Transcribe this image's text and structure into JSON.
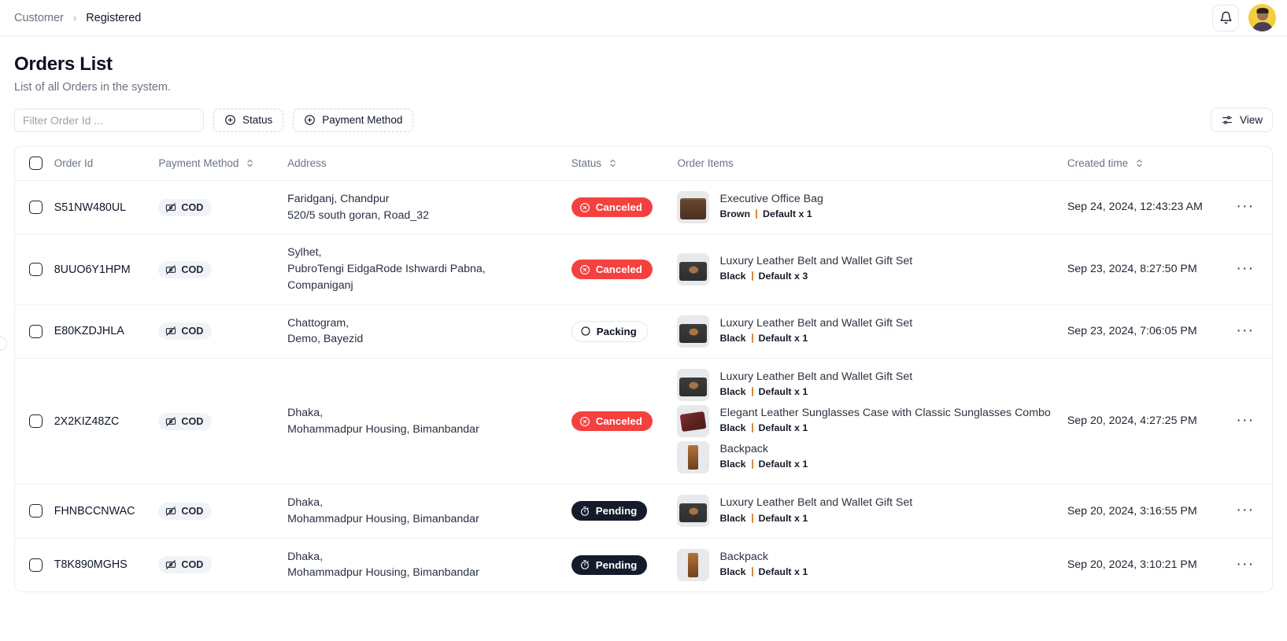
{
  "breadcrumb": {
    "parent": "Customer",
    "separator": "›",
    "current": "Registered"
  },
  "topbar": {
    "bell_icon": "bell-icon",
    "avatar_label": "User avatar"
  },
  "page": {
    "title": "Orders List",
    "subtitle": "List of all Orders in the system."
  },
  "toolbar": {
    "filter_placeholder": "Filter Order Id ...",
    "filter_value": "",
    "status_filter_label": "Status",
    "payment_filter_label": "Payment Method",
    "view_label": "View"
  },
  "table": {
    "columns": [
      {
        "key": "check",
        "label": ""
      },
      {
        "key": "order_id",
        "label": "Order Id",
        "sortable": false
      },
      {
        "key": "payment_method",
        "label": "Payment Method",
        "sortable": true
      },
      {
        "key": "address",
        "label": "Address",
        "sortable": false
      },
      {
        "key": "status",
        "label": "Status",
        "sortable": true
      },
      {
        "key": "order_items",
        "label": "Order Items",
        "sortable": false
      },
      {
        "key": "created_time",
        "label": "Created time",
        "sortable": true
      }
    ],
    "rows": [
      {
        "order_id": "S51NW480UL",
        "payment_method": "COD",
        "address": [
          "Faridganj, Chandpur",
          "520/5 south goran, Road_32"
        ],
        "status": "Canceled",
        "status_kind": "canceled",
        "items": [
          {
            "name": "Executive Office Bag",
            "variant": "Brown",
            "option": "Default x 1",
            "thumb": "bag-brown"
          }
        ],
        "created_time": "Sep 24, 2024, 12:43:23 AM"
      },
      {
        "order_id": "8UUO6Y1HPM",
        "payment_method": "COD",
        "address": [
          "Sylhet,",
          "PubroTengi EidgaRode Ishwardi Pabna,",
          "Companiganj"
        ],
        "status": "Canceled",
        "status_kind": "canceled",
        "items": [
          {
            "name": "Luxury Leather Belt and Wallet Gift Set",
            "variant": "Black",
            "option": "Default x 3",
            "thumb": "giftset"
          }
        ],
        "created_time": "Sep 23, 2024, 8:27:50 PM"
      },
      {
        "order_id": "E80KZDJHLA",
        "payment_method": "COD",
        "address": [
          "Chattogram,",
          "Demo, Bayezid"
        ],
        "status": "Packing",
        "status_kind": "packing",
        "items": [
          {
            "name": "Luxury Leather Belt and Wallet Gift Set",
            "variant": "Black",
            "option": "Default x 1",
            "thumb": "giftset"
          }
        ],
        "created_time": "Sep 23, 2024, 7:06:05 PM"
      },
      {
        "order_id": "2X2KIZ48ZC",
        "payment_method": "COD",
        "address": [
          "Dhaka,",
          "Mohammadpur Housing, Bimanbandar"
        ],
        "status": "Canceled",
        "status_kind": "canceled",
        "items": [
          {
            "name": "Luxury Leather Belt and Wallet Gift Set",
            "variant": "Black",
            "option": "Default x 1",
            "thumb": "giftset"
          },
          {
            "name": "Elegant Leather Sunglasses Case with Classic Sunglasses Combo",
            "variant": "Black",
            "option": "Default x 1",
            "thumb": "sunglasses"
          },
          {
            "name": "Backpack",
            "variant": "Black",
            "option": "Default x 1",
            "thumb": "backpack"
          }
        ],
        "created_time": "Sep 20, 2024, 4:27:25 PM"
      },
      {
        "order_id": "FHNBCCNWAC",
        "payment_method": "COD",
        "address": [
          "Dhaka,",
          "Mohammadpur Housing, Bimanbandar"
        ],
        "status": "Pending",
        "status_kind": "pending",
        "items": [
          {
            "name": "Luxury Leather Belt and Wallet Gift Set",
            "variant": "Black",
            "option": "Default x 1",
            "thumb": "giftset"
          }
        ],
        "created_time": "Sep 20, 2024, 3:16:55 PM"
      },
      {
        "order_id": "T8K890MGHS",
        "payment_method": "COD",
        "address": [
          "Dhaka,",
          "Mohammadpur Housing, Bimanbandar"
        ],
        "status": "Pending",
        "status_kind": "pending",
        "items": [
          {
            "name": "Backpack",
            "variant": "Black",
            "option": "Default x 1",
            "thumb": "backpack"
          }
        ],
        "created_time": "Sep 20, 2024, 3:10:21 PM"
      }
    ],
    "row_menu_label": "···"
  },
  "colors": {
    "canceled": "#f4413f",
    "pending": "#141b2b",
    "packing_border": "#e4e7ec",
    "cod_badge_bg": "#f1f3f7",
    "avatar_bg": "#f4cf3a"
  }
}
